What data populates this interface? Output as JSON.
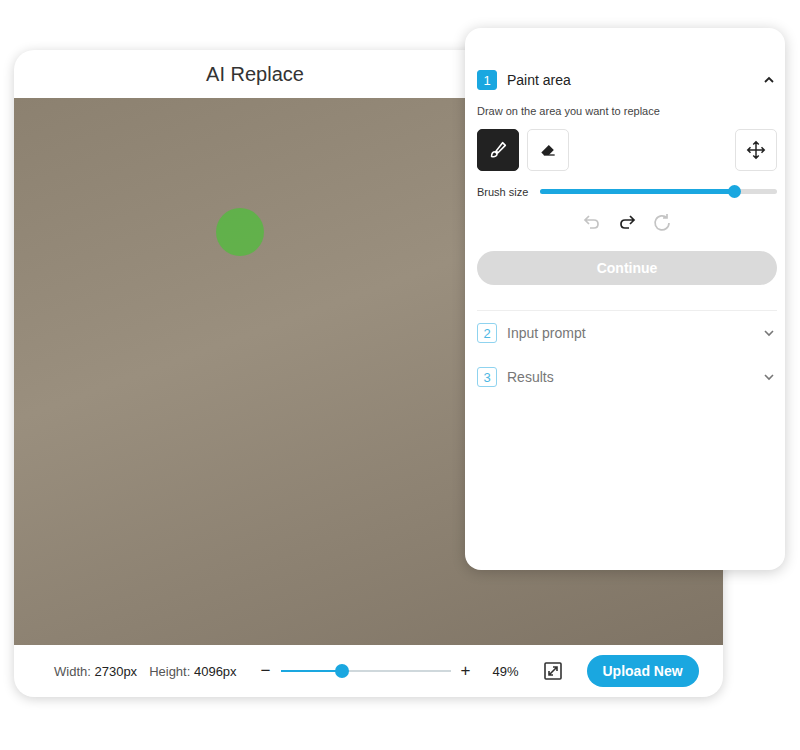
{
  "editor": {
    "title": "AI Replace",
    "footer": {
      "width_label": "Width:",
      "width": "2730px",
      "height_label": "Height:",
      "height": "4096px",
      "zoom_out": "−",
      "zoom_in": "+",
      "zoom": {
        "level": 0.36,
        "reading": "49%"
      },
      "upload_button": "Upload New"
    }
  },
  "panel": {
    "steps": [
      {
        "number": "1",
        "title": "Paint area",
        "expanded": true,
        "active": true
      },
      {
        "number": "2",
        "title": "Input prompt",
        "expanded": false,
        "active": false
      },
      {
        "number": "3",
        "title": "Results",
        "expanded": false,
        "active": false
      }
    ],
    "paint": {
      "hint": "Draw on the area you want to replace",
      "tools": [
        {
          "kind": "brush",
          "selected": true
        },
        {
          "kind": "eraser",
          "selected": false
        },
        {
          "kind": "move",
          "selected": false
        }
      ],
      "brush_size": {
        "label": "Brush size",
        "level": 0.82
      },
      "history": [
        {
          "kind": "undo",
          "disabled": true
        },
        {
          "kind": "redo",
          "disabled": false
        },
        {
          "kind": "reset",
          "disabled": true
        }
      ],
      "continue": {
        "label": "Continue",
        "disabled": true
      }
    }
  }
}
